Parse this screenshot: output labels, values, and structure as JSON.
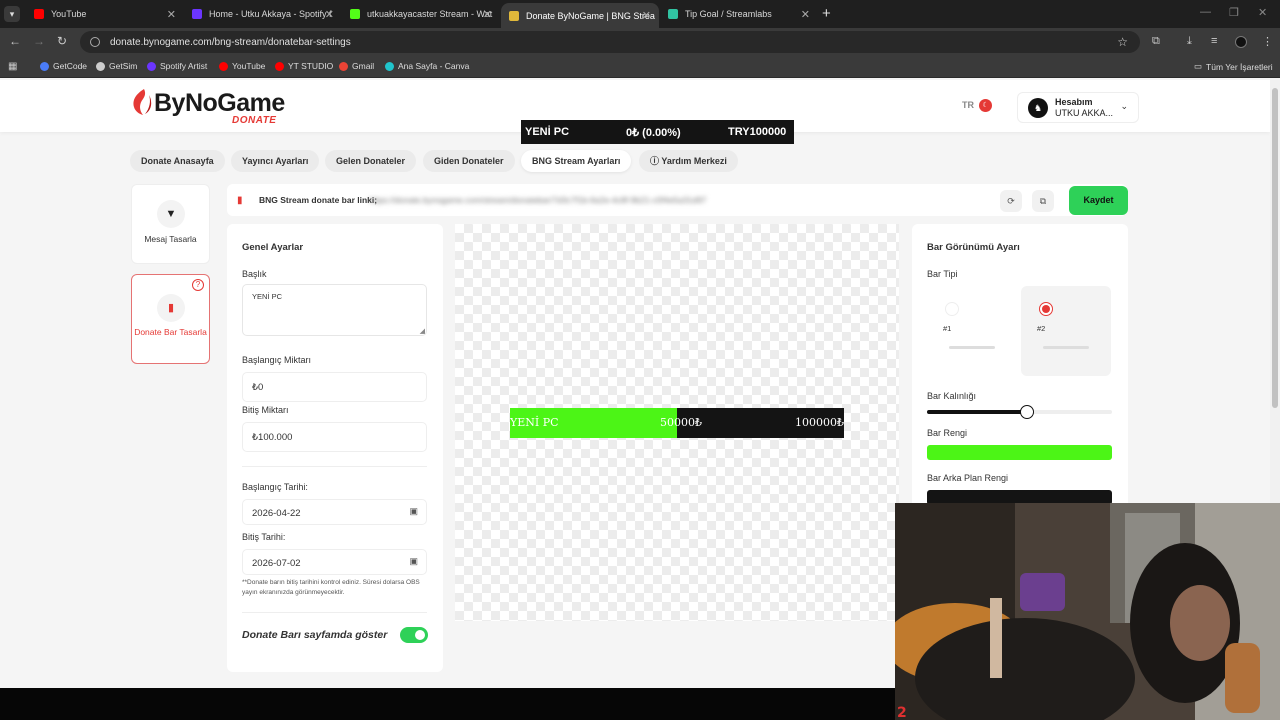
{
  "browser": {
    "tabs": [
      {
        "title": "YouTube",
        "color": "#ff0000"
      },
      {
        "title": "Home - Utku Akkaya - Spotify f",
        "color": "#6b35ff"
      },
      {
        "title": "utkuakkayacaster Stream - Wat",
        "color": "#53fc18"
      },
      {
        "title": "Donate ByNoGame | BNG Strea",
        "color": "#e0b83a"
      },
      {
        "title": "Tip Goal / Streamlabs",
        "color": "#31c3a2"
      }
    ],
    "url": "donate.bynogame.com/bng-stream/donatebar-settings",
    "bookmarks": [
      {
        "label": "GetCode",
        "color": "#4a7cf7"
      },
      {
        "label": "GetSim",
        "color": "#cccccc"
      },
      {
        "label": "Spotify Artist",
        "color": "#6b35ff"
      },
      {
        "label": "YouTube",
        "color": "#ff0000"
      },
      {
        "label": "YT STUDIO",
        "color": "#ff0000"
      },
      {
        "label": "Gmail",
        "color": "#ea4335"
      },
      {
        "label": "Ana Sayfa - Canva",
        "color": "#20c4cb"
      }
    ],
    "all_bookmarks": "Tüm Yer İşaretleri"
  },
  "header": {
    "brand": "ByNoGame",
    "brand_sub": "DONATE",
    "lang": "TR",
    "account_title": "Hesabım",
    "account_name": "UTKU AKKA..."
  },
  "overlay_bar": {
    "title": "YENİ PC",
    "amount": "0₺ (0.00%)",
    "goal": "TRY100000"
  },
  "nav": {
    "tabs": [
      "Donate Anasayfa",
      "Yayıncı Ayarları",
      "Gelen Donateler",
      "Giden Donateler",
      "BNG Stream Ayarları"
    ],
    "help": "Yardım Merkezi",
    "active_index": 4
  },
  "sidebar": {
    "message_design": "Mesaj Tasarla",
    "bar_design": "Donate Bar Tasarla"
  },
  "linkbar": {
    "label": "BNG Stream donate bar linki;",
    "url": "https://donate.bynogame.com/stream/donatebar/7d3c7f1b-6a2e-4c8f-9b21-c0f4e5a31d97",
    "save": "Kaydet"
  },
  "general": {
    "title": "Genel Ayarlar",
    "baslik_label": "Başlık",
    "baslik_value": "YENİ PC",
    "start_amount_label": "Başlangıç Miktarı",
    "start_amount_value": "₺0",
    "end_amount_label": "Bitiş Miktarı",
    "end_amount_value": "₺100.000",
    "start_date_label": "Başlangıç Tarihi:",
    "start_date_value": "2026-04-22",
    "end_date_label": "Bitiş Tarihi:",
    "end_date_value": "2026-07-02",
    "note": "**Donate barın bitiş tarihini kontrol ediniz. Süresi dolarsa OBS yayın ekranınızda görünmeyecektir.",
    "show_label": "Donate Barı sayfamda göster",
    "show_enabled": true
  },
  "preview": {
    "title": "YENİ PC",
    "current": "50000₺",
    "goal": "100000₺",
    "fill_fraction": 0.5
  },
  "appearance": {
    "title": "Bar Görünümü Ayarı",
    "type_label": "Bar Tipi",
    "type_options": [
      "#1",
      "#2"
    ],
    "selected_type": "#2",
    "thickness_label": "Bar Kalınlığı",
    "thickness_fraction": 0.54,
    "bar_color_label": "Bar Rengi",
    "bar_color": "#4cf516",
    "bg_color_label": "Bar Arka Plan Rengi",
    "bg_color": "#141414"
  },
  "colors": {
    "accent_red": "#e53935",
    "accent_green": "#2ed158"
  }
}
